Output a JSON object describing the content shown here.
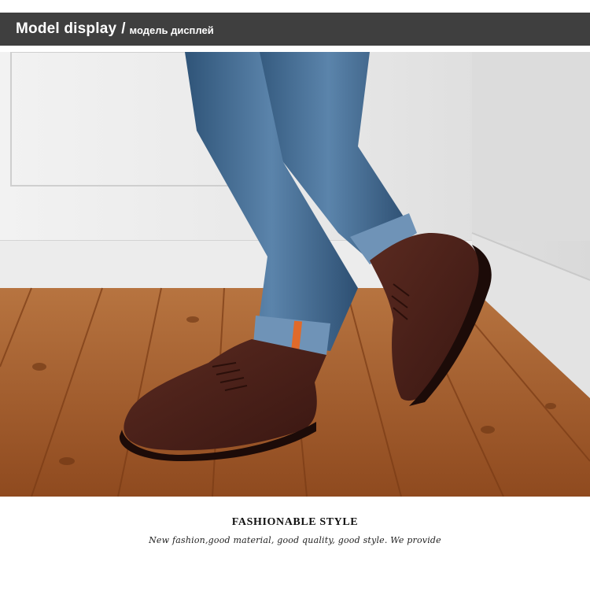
{
  "header": {
    "title": "Model display",
    "separator": "/",
    "subtitle": "модель дисплей"
  },
  "photo": {
    "subject": "model-wearing-suede-boots",
    "colors": {
      "wall": "#e9e9e9",
      "floor": "#a85f2c",
      "denim": "#3f6a94",
      "boot": "#4a1f18",
      "cuff_stripe": "#e06a2a"
    }
  },
  "footer": {
    "tagline": "FASHIONABLE STYLE",
    "description": "New fashion,good material, good quality, good style. We provide"
  }
}
